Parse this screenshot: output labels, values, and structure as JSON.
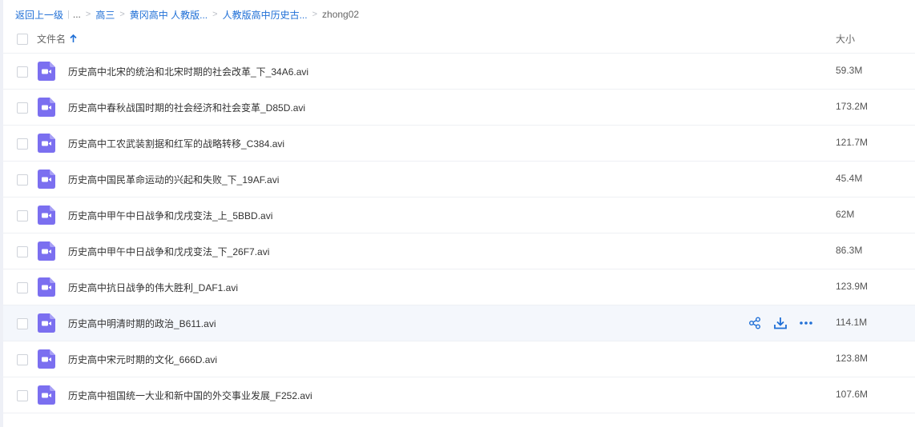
{
  "breadcrumb": {
    "back": "返回上一级",
    "ellipsis": "...",
    "items": [
      "高三",
      "黄冈高中 人教版...",
      "人教版高中历史古...",
      "zhong02"
    ]
  },
  "header": {
    "name_col": "文件名",
    "size_col": "大小"
  },
  "colors": {
    "accent": "#1f6fd6",
    "video_icon": "#7b6ff0",
    "hover_row": "#f4f7fc"
  },
  "files": [
    {
      "name": "历史高中北宋的统治和北宋时期的社会改革_下_34A6.avi",
      "size": "59.3M",
      "icon": "video-file-icon"
    },
    {
      "name": "历史高中春秋战国时期的社会经济和社会变革_D85D.avi",
      "size": "173.2M",
      "icon": "video-file-icon"
    },
    {
      "name": "历史高中工农武装割据和红军的战略转移_C384.avi",
      "size": "121.7M",
      "icon": "video-file-icon"
    },
    {
      "name": "历史高中国民革命运动的兴起和失败_下_19AF.avi",
      "size": "45.4M",
      "icon": "video-file-icon"
    },
    {
      "name": "历史高中甲午中日战争和戊戌变法_上_5BBD.avi",
      "size": "62M",
      "icon": "video-file-icon"
    },
    {
      "name": "历史高中甲午中日战争和戊戌变法_下_26F7.avi",
      "size": "86.3M",
      "icon": "video-file-icon"
    },
    {
      "name": "历史高中抗日战争的伟大胜利_DAF1.avi",
      "size": "123.9M",
      "icon": "video-file-icon"
    },
    {
      "name": "历史高中明清时期的政治_B611.avi",
      "size": "114.1M",
      "icon": "video-file-icon"
    },
    {
      "name": "历史高中宋元时期的文化_666D.avi",
      "size": "123.8M",
      "icon": "video-file-icon"
    },
    {
      "name": "历史高中祖国统一大业和新中国的外交事业发展_F252.avi",
      "size": "107.6M",
      "icon": "video-file-icon"
    }
  ],
  "hover_row_index": 7,
  "row_actions": [
    "share-icon",
    "download-icon",
    "more-icon"
  ]
}
